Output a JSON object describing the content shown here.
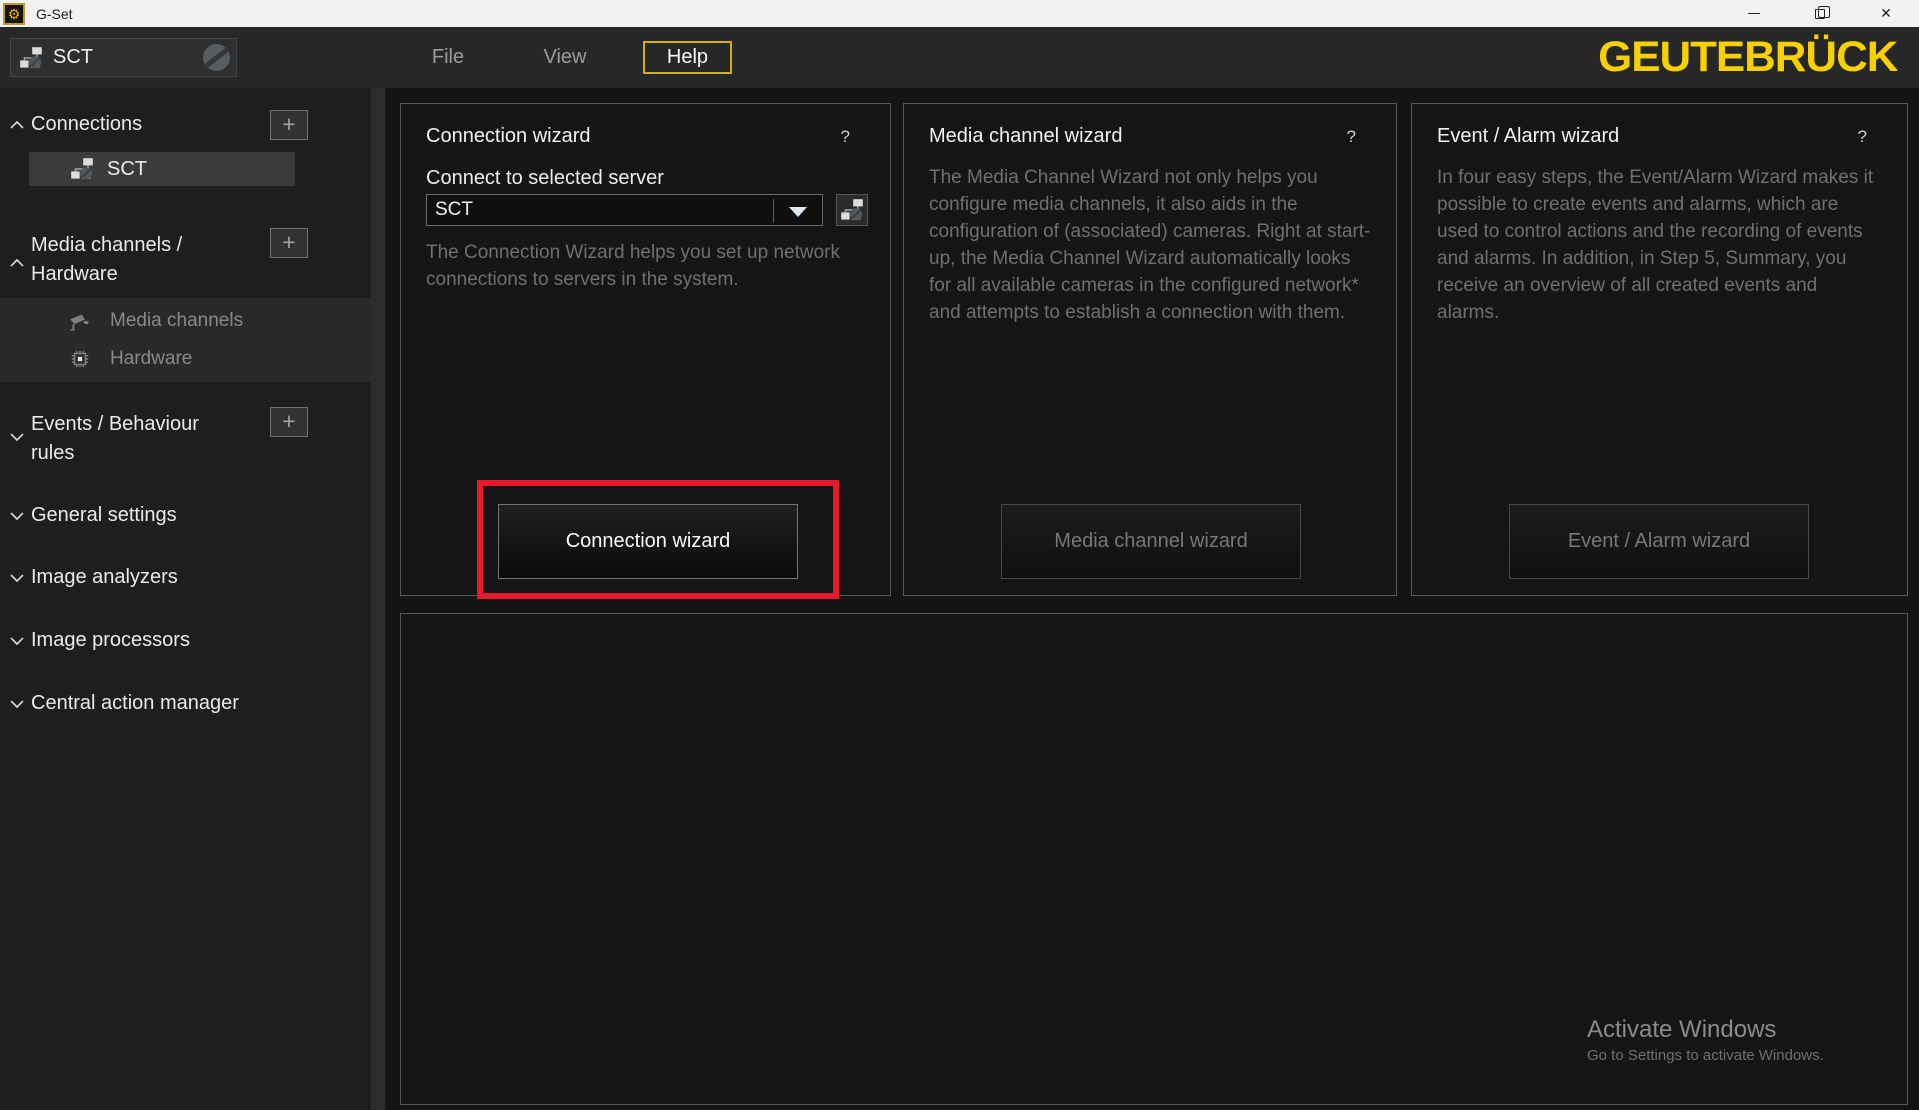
{
  "window": {
    "title": "G-Set",
    "close_glyph": "✕"
  },
  "toolbar": {
    "server_selector": {
      "value": "SCT"
    },
    "menus": {
      "file": "File",
      "view": "View",
      "help": "Help"
    },
    "logo": "GEUTEBRÜCK"
  },
  "sidebar": {
    "add_icon": "+",
    "sections": [
      {
        "label": "Connections",
        "expanded": true
      },
      {
        "label": "Media channels /\nHardware",
        "expanded": true
      },
      {
        "label": "Events / Behaviour\nrules",
        "expanded": false
      },
      {
        "label": "General settings",
        "expanded": false
      },
      {
        "label": "Image analyzers",
        "expanded": false
      },
      {
        "label": "Image processors",
        "expanded": false
      },
      {
        "label": "Central action manager",
        "expanded": false
      }
    ],
    "connections_items": [
      {
        "label": "SCT"
      }
    ],
    "media_items": [
      {
        "label": "Media channels"
      },
      {
        "label": "Hardware"
      }
    ]
  },
  "main": {
    "cards": [
      {
        "title": "Connection wizard",
        "help": "?",
        "connect_label": "Connect to selected server",
        "server_value": "SCT",
        "description": "The Connection Wizard helps you set up network connections to servers in the system.",
        "button": "Connection wizard"
      },
      {
        "title": "Media channel wizard",
        "help": "?",
        "description": "The Media Channel Wizard not only helps you configure media channels, it also aids in the configuration of (associated) cameras. Right at start-up, the Media Channel Wizard automatically looks for all available cameras in the configured network* and attempts to establish a connection with them.",
        "button": "Media channel wizard"
      },
      {
        "title": "Event / Alarm wizard",
        "help": "?",
        "description": "In four easy steps, the Event/Alarm Wizard makes it possible to create events and alarms, which are used to control actions and the recording of events and alarms. In addition, in Step 5, Summary, you receive an overview of all created events and alarms.",
        "button": "Event / Alarm wizard"
      }
    ]
  },
  "watermark": {
    "title": "Activate Windows",
    "subtitle": "Go to Settings to activate Windows."
  },
  "colors": {
    "brand_yellow": "#f6d000",
    "help_border_yellow": "#d9ae00",
    "highlight_red": "#e8192c",
    "titlebar_bg": "#f2f2f2",
    "toolbar_bg": "#262728",
    "sidebar_bg": "#1d1e1f",
    "main_bg": "#141414"
  }
}
